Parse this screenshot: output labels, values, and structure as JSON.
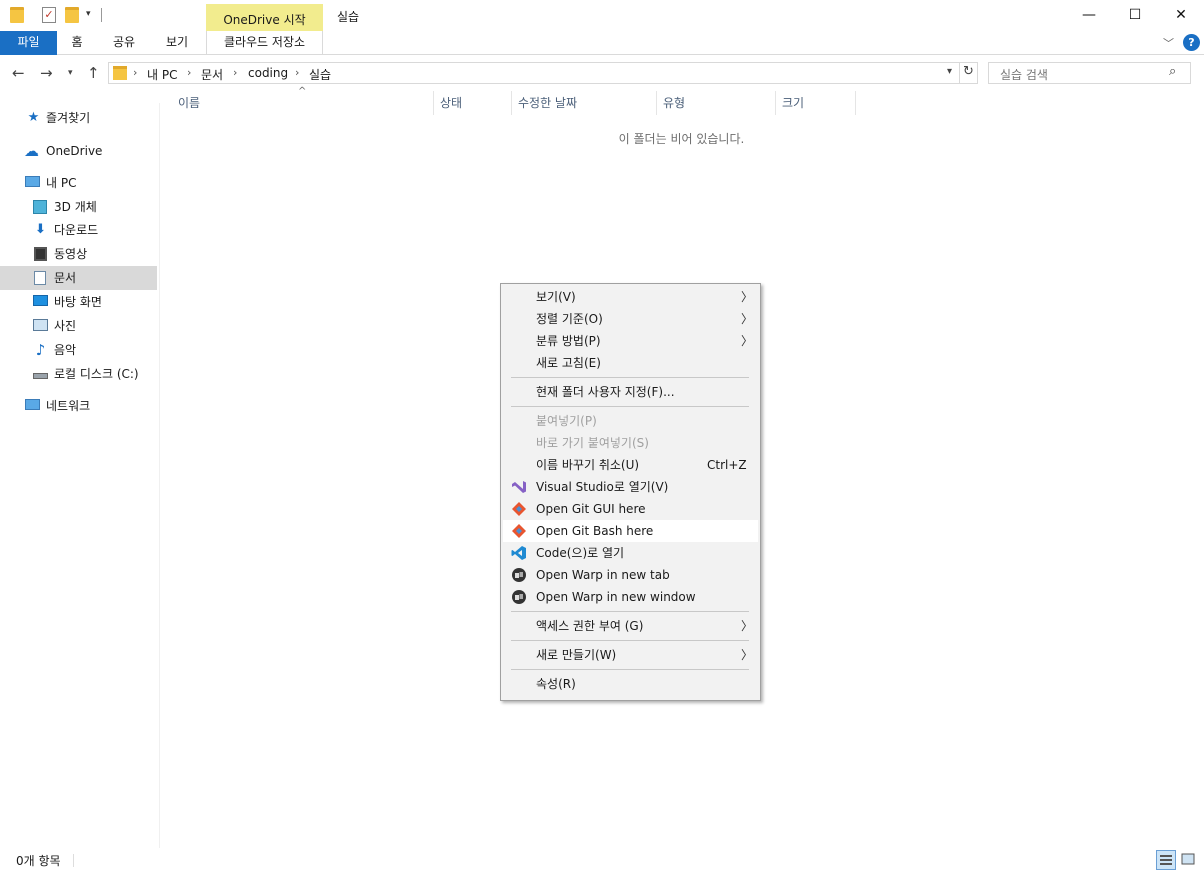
{
  "window": {
    "title": "실습",
    "context_tab": "OneDrive 시작",
    "minimize_glyph": "—",
    "maximize_glyph": "☐",
    "close_glyph": "✕"
  },
  "ribbon": {
    "tabs": [
      "파일",
      "홈",
      "공유",
      "보기"
    ],
    "context_subtab": "클라우드 저장소",
    "accent_color": "#1a6fc4",
    "context_color": "#f2ec8e"
  },
  "address": {
    "crumbs": [
      "내 PC",
      "문서",
      "coding",
      "실습"
    ],
    "search_placeholder": "실습 검색"
  },
  "navpane": {
    "items": [
      {
        "label": "즐겨찾기",
        "icon": "star-icon"
      },
      {
        "label": "OneDrive",
        "icon": "cloud-icon"
      },
      {
        "label": "내 PC",
        "icon": "monitor-icon"
      },
      {
        "label": "3D 개체",
        "icon": "cube-icon"
      },
      {
        "label": "다운로드",
        "icon": "download-arrow-icon"
      },
      {
        "label": "동영상",
        "icon": "film-icon"
      },
      {
        "label": "문서",
        "icon": "document-icon"
      },
      {
        "label": "바탕 화면",
        "icon": "desktop-icon"
      },
      {
        "label": "사진",
        "icon": "picture-icon"
      },
      {
        "label": "음악",
        "icon": "music-note-icon"
      },
      {
        "label": "로컬 디스크 (C:)",
        "icon": "drive-icon"
      },
      {
        "label": "네트워크",
        "icon": "network-icon"
      }
    ],
    "selected": "문서"
  },
  "columns": [
    "이름",
    "상태",
    "수정한 날짜",
    "유형",
    "크기"
  ],
  "empty_message": "이 폴더는 비어 있습니다.",
  "context_menu": {
    "items": [
      {
        "label": "보기(V)",
        "submenu": true
      },
      {
        "label": "정렬 기준(O)",
        "submenu": true
      },
      {
        "label": "분류 방법(P)",
        "submenu": true
      },
      {
        "label": "새로 고침(E)"
      },
      {
        "label": "현재 폴더 사용자 지정(F)..."
      },
      {
        "label": "붙여넣기(P)",
        "disabled": true
      },
      {
        "label": "바로 가기 붙여넣기(S)",
        "disabled": true
      },
      {
        "label": "이름 바꾸기 취소(U)",
        "shortcut": "Ctrl+Z"
      },
      {
        "label": "Visual Studio로 열기(V)",
        "icon": "visual-studio-icon"
      },
      {
        "label": "Open Git GUI here",
        "icon": "git-icon"
      },
      {
        "label": "Open Git Bash here",
        "icon": "git-icon",
        "hovered": true
      },
      {
        "label": "Code(으)로 열기",
        "icon": "vscode-icon"
      },
      {
        "label": "Open Warp in new tab",
        "icon": "warp-icon"
      },
      {
        "label": "Open Warp in new window",
        "icon": "warp-icon"
      },
      {
        "label": "액세스 권한 부여 (G)",
        "submenu": true
      },
      {
        "label": "새로 만들기(W)",
        "submenu": true
      },
      {
        "label": "속성(R)"
      }
    ]
  },
  "status": {
    "item_count": "0개 항목"
  }
}
